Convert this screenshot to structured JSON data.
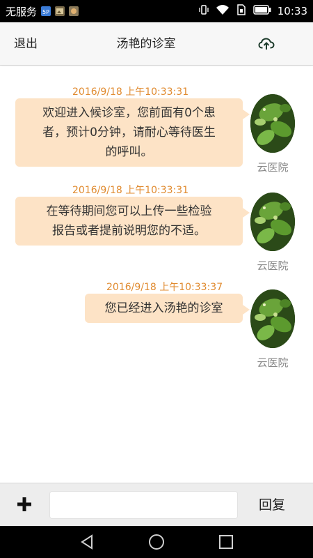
{
  "status_bar": {
    "carrier": "无服务",
    "time": "10:33",
    "icons": [
      "5g-badge-icon",
      "image-notification-icon",
      "app-notification-icon",
      "vibrate-icon",
      "wifi-icon",
      "sim-icon",
      "battery-icon"
    ]
  },
  "header": {
    "exit_label": "退出",
    "title": "汤艳的诊室",
    "upload_icon": "cloud-upload-icon"
  },
  "messages": [
    {
      "time": "2016/9/18 上午10:33:31",
      "lines": [
        "欢迎进入候诊室，您前面有0个患",
        "者，预计0分钟，请耐心等待医生",
        "的呼叫。"
      ],
      "sender": "云医院"
    },
    {
      "time": "2016/9/18 上午10:33:31",
      "lines": [
        "在等待期间您可以上传一些检验",
        "报告或者提前说明您的不适。"
      ],
      "sender": "云医院"
    },
    {
      "time": "2016/9/18 上午10:33:37",
      "lines": [
        "您已经进入汤艳的诊室"
      ],
      "sender": "云医院"
    }
  ],
  "input_bar": {
    "plus_icon": "plus-icon",
    "input_value": "",
    "reply_label": "回复"
  },
  "nav_bar": {
    "icons": [
      "back-triangle-icon",
      "home-circle-icon",
      "recents-square-icon"
    ]
  },
  "colors": {
    "bubble": "#fde3c6",
    "timestamp": "#e08a2e",
    "header_bg": "#f7f7f7",
    "input_bar_bg": "#ededed"
  }
}
